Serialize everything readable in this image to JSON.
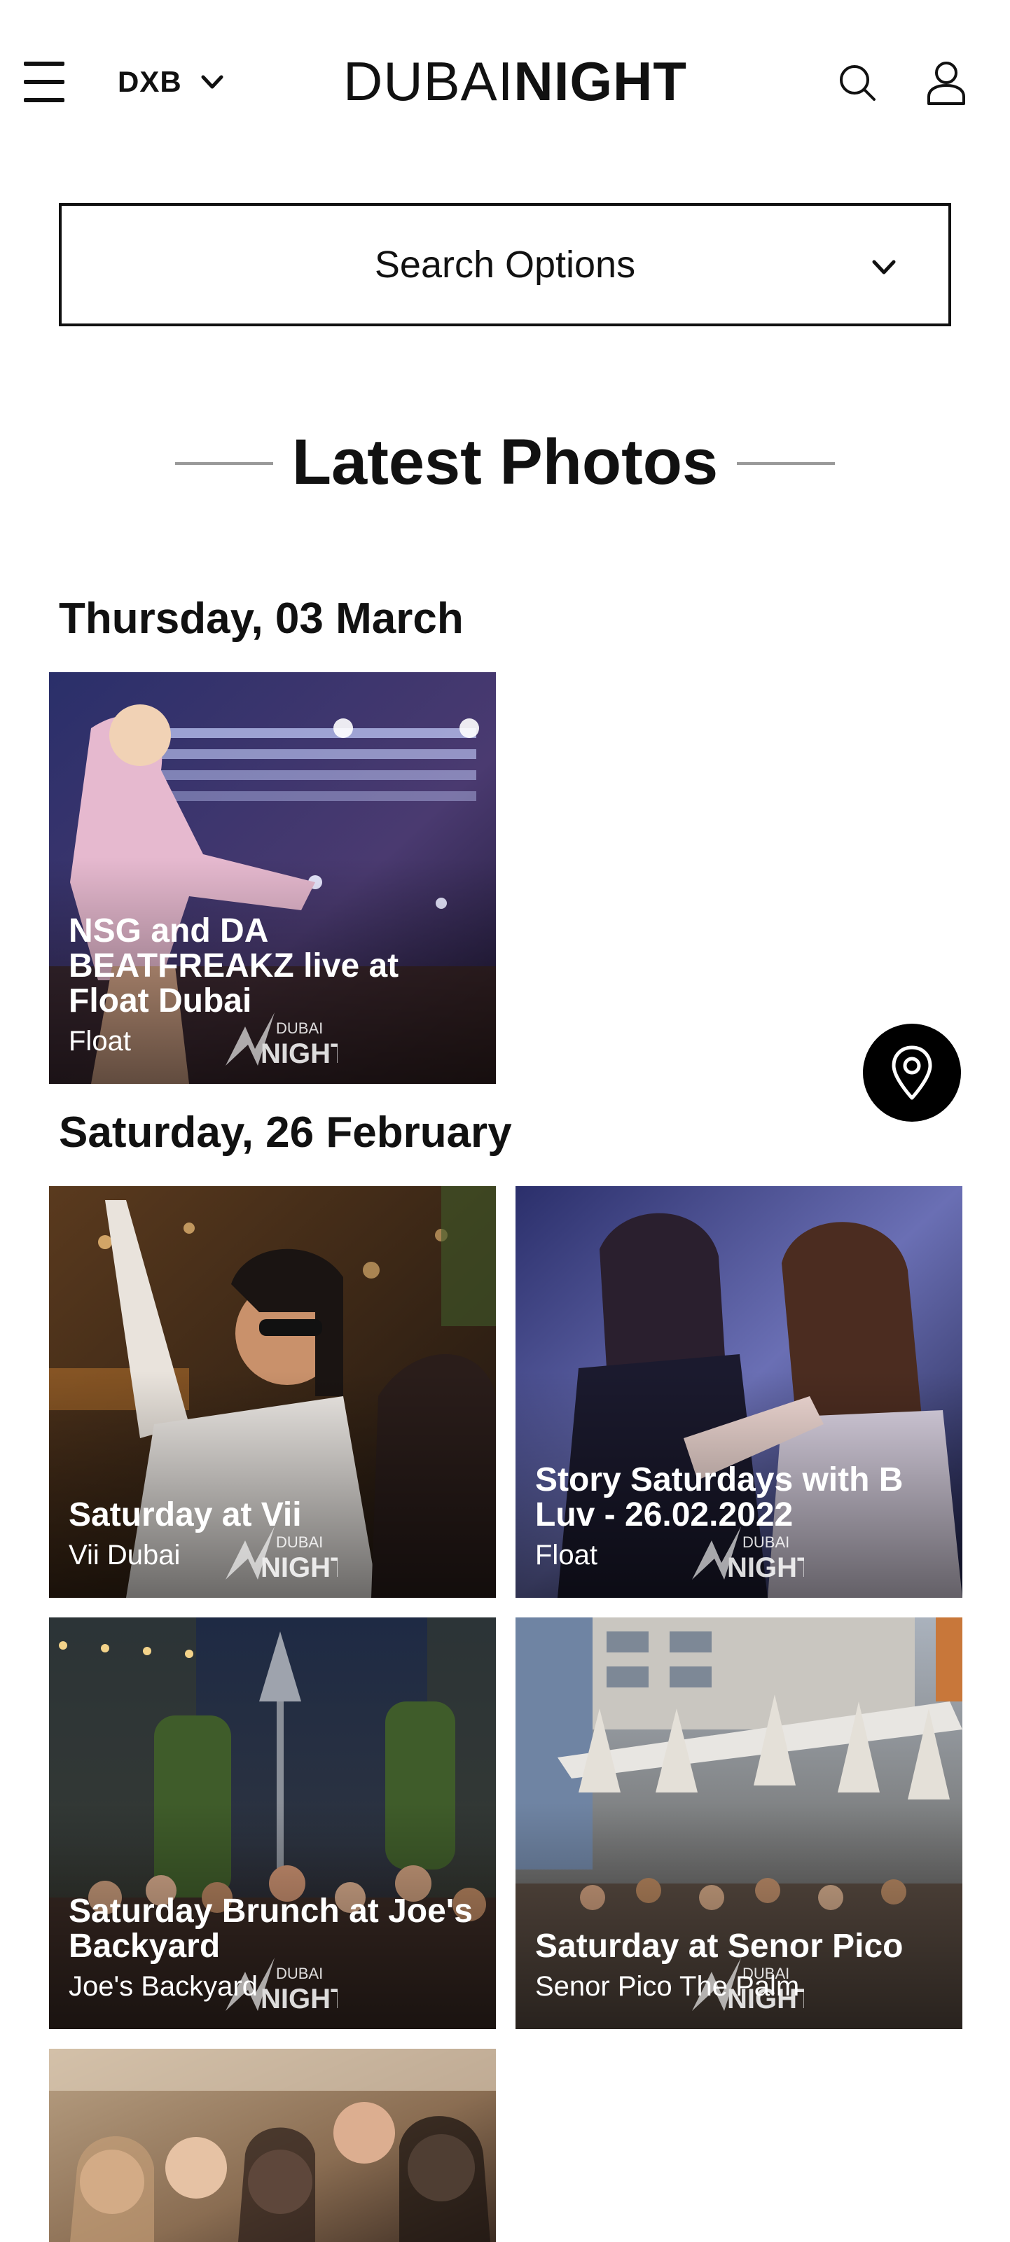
{
  "header": {
    "city": "DXB",
    "logo_light": "DUBAI",
    "logo_bold": "NIGHT"
  },
  "search": {
    "label": "Search Options"
  },
  "section": {
    "title": "Latest Photos"
  },
  "groups": [
    {
      "date": "Thursday, 03 March",
      "items": [
        {
          "title": "NSG and DA BEATFREAKZ live at Float Dubai",
          "venue": "Float"
        }
      ]
    },
    {
      "date": "Saturday, 26 February",
      "items": [
        {
          "title": "Saturday at Vii",
          "venue": "Vii Dubai"
        },
        {
          "title": "Story Saturdays with B Luv - 26.02.2022",
          "venue": "Float"
        },
        {
          "title": "Saturday Brunch at Joe's Backyard",
          "venue": "Joe's Backyard"
        },
        {
          "title": "Saturday at Senor Pico",
          "venue": "Senor Pico The Palm"
        }
      ]
    }
  ],
  "watermark": {
    "top": "DUBAI",
    "bottom": "NIGHT"
  },
  "colors": {
    "text": "#111111",
    "background": "#ffffff",
    "fab": "#000000",
    "overlay_text": "#ffffff"
  },
  "icons": {
    "menu": "hamburger-icon",
    "city_dropdown": "chevron-down-icon",
    "search": "search-icon",
    "account": "user-icon",
    "map": "map-pin-icon"
  }
}
